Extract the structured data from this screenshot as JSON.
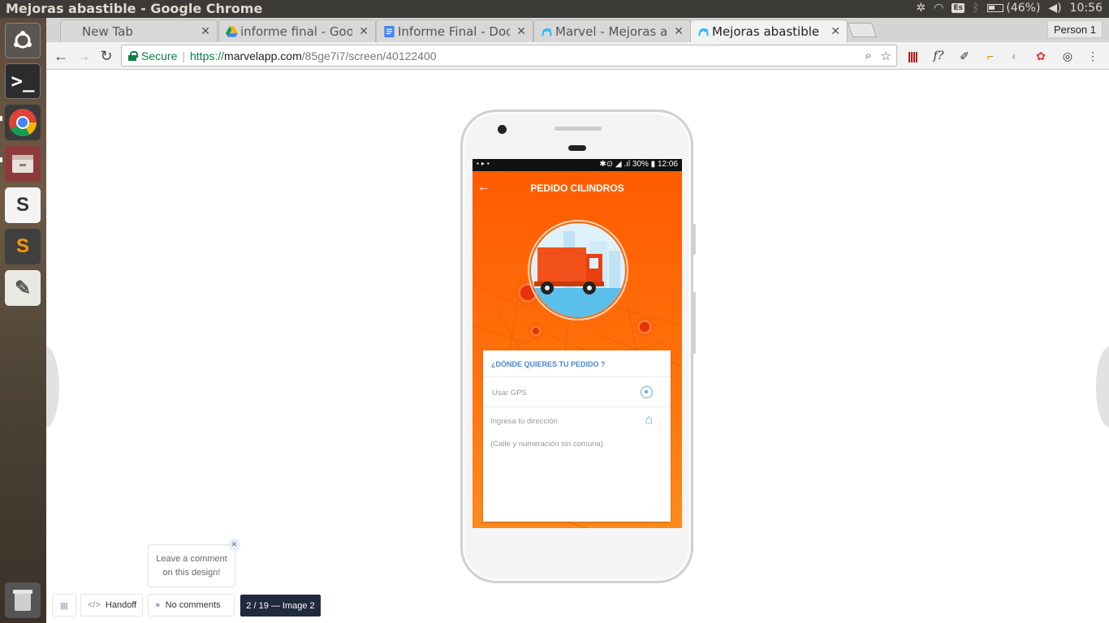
{
  "window": {
    "title": "Mejoras abastible - Google Chrome"
  },
  "system_tray": {
    "keyboard": "Es",
    "battery": "(46%)",
    "time": "10:56",
    "icons": [
      "network-settings-icon",
      "wifi-icon",
      "keyboard-layout-icon",
      "bluetooth-icon",
      "battery-icon",
      "volume-icon"
    ]
  },
  "launcher": {
    "items": [
      {
        "name": "ubuntu-dash-icon"
      },
      {
        "name": "terminal-icon",
        "glyph": ">_"
      },
      {
        "name": "chrome-icon"
      },
      {
        "name": "files-icon"
      },
      {
        "name": "slack-icon",
        "glyph": "S"
      },
      {
        "name": "sublime-text-icon",
        "glyph": "S"
      },
      {
        "name": "text-editor-icon",
        "glyph": "✎"
      },
      {
        "name": "trash-icon"
      }
    ]
  },
  "tabs": [
    {
      "label": "New Tab",
      "favicon": "none",
      "active": false
    },
    {
      "label": "informe final - Goog",
      "favicon": "google-drive-icon",
      "active": false
    },
    {
      "label": "Informe Final - Doc",
      "favicon": "google-docs-icon",
      "active": false
    },
    {
      "label": "Marvel - Mejoras ab",
      "favicon": "marvel-icon",
      "active": false
    },
    {
      "label": "Mejoras abastible",
      "favicon": "marvel-icon",
      "active": true
    }
  ],
  "profile": {
    "label": "Person 1"
  },
  "omnibox": {
    "secure_label": "Secure",
    "scheme": "https://",
    "host": "marvelapp.com",
    "path": "/85ge7i7/screen/40122400"
  },
  "phone_screen": {
    "status_time": "12:06",
    "status_battery": "30%",
    "title": "PEDIDO CILINDROS",
    "card_heading": "¿DÓNDE QUIERES TU PEDIDO ?",
    "gps_label": "Usar GPS",
    "address_label": "Ingresa tu dirección",
    "address_hint": "(Calle y numeración sin comuna)"
  },
  "marvel_toolbar": {
    "handoff": "Handoff",
    "comments": "No comments",
    "counter": "2 / 19 — Image 2",
    "tip_line1": "Leave a comment",
    "tip_line2": "on this design!"
  },
  "colors": {
    "brand_orange": "#ff5a00",
    "accent_blue": "#4a86c5",
    "counter_bg": "#1f2a3c"
  }
}
